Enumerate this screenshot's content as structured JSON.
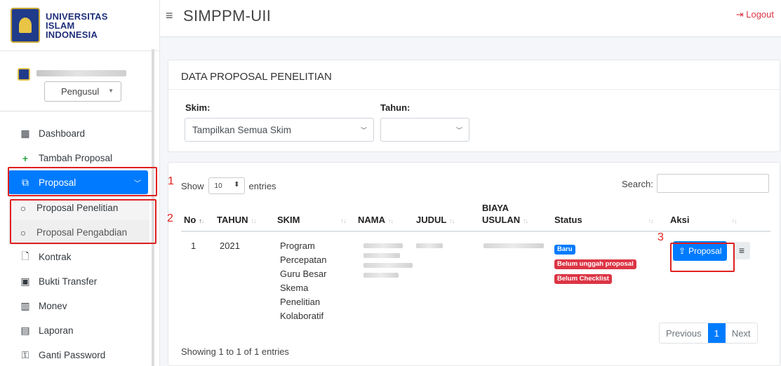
{
  "brand": {
    "line1": "UNIVERSITAS",
    "line2": "ISLAM",
    "line3": "INDONESIA"
  },
  "user": {
    "role": "Pengusul"
  },
  "menu": {
    "dashboard": "Dashboard",
    "tambah": "Tambah Proposal",
    "proposal": "Proposal",
    "penelitian": "Proposal Penelitian",
    "pengabdian": "Proposal Pengabdian",
    "kontrak": "Kontrak",
    "bukti": "Bukti Transfer",
    "monev": "Monev",
    "laporan": "Laporan",
    "password": "Ganti Password"
  },
  "header": {
    "title": "SIMPPM-UII",
    "logout": "Logout"
  },
  "card1": {
    "title": "DATA PROPOSAL PENELITIAN",
    "skim_label": "Skim:",
    "skim_value": "Tampilkan Semua Skim",
    "tahun_label": "Tahun:",
    "tahun_value": ""
  },
  "table_ctrl": {
    "show": "Show",
    "entries_value": "10",
    "entries": "entries",
    "search": "Search:"
  },
  "columns": {
    "no": "No",
    "tahun": "TAHUN",
    "skim": "SKIM",
    "nama": "NAMA",
    "judul": "JUDUL",
    "biaya1": "BIAYA",
    "biaya2": "USULAN",
    "status": "Status",
    "aksi": "Aksi"
  },
  "row": {
    "no": "1",
    "tahun": "2021",
    "skim": [
      "Program",
      "Percepatan",
      "Guru Besar",
      "Skema",
      "Penelitian",
      "Kolaboratif"
    ],
    "badges": [
      "Baru",
      "Belum unggah proposal",
      "Belum Checklist"
    ],
    "btn": "Proposal"
  },
  "footer": {
    "showing": "Showing 1 to 1 of 1 entries",
    "prev": "Previous",
    "page": "1",
    "next": "Next"
  },
  "annotations": {
    "n1": "1",
    "n2": "2",
    "n3": "3"
  },
  "colors": {
    "primary": "#007bff",
    "danger": "#dc3545",
    "annot": "#e02020"
  }
}
